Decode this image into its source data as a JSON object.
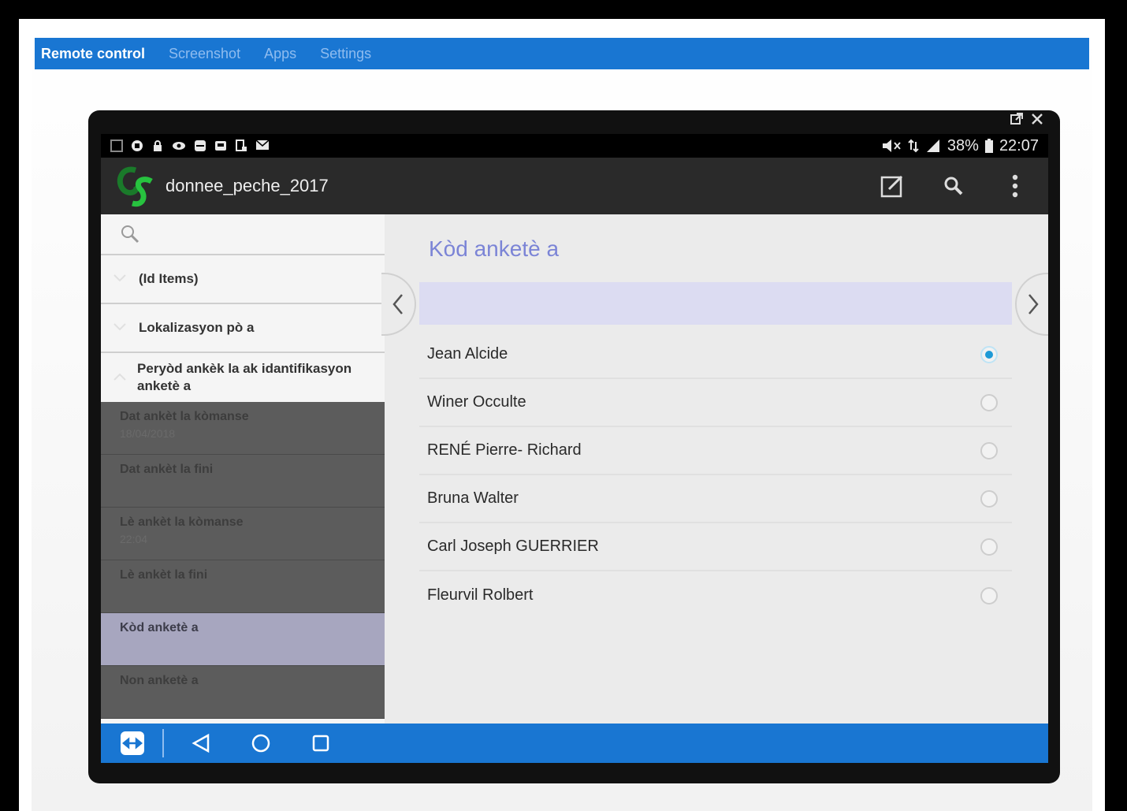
{
  "remote_nav": {
    "items": [
      {
        "label": "Remote control",
        "active": true
      },
      {
        "label": "Screenshot"
      },
      {
        "label": "Apps"
      },
      {
        "label": "Settings"
      }
    ]
  },
  "device": {
    "window_controls": {
      "detach_icon": "detach-icon",
      "close_icon": "close-icon"
    },
    "status_bar": {
      "left_icons": [
        "notification-icon",
        "vpn-icon",
        "lock-icon",
        "eye-icon",
        "teamviewer-icon",
        "wifi-icon",
        "screenshot-icon",
        "email-icon"
      ],
      "battery": "38%",
      "time": "22:07"
    },
    "action_bar": {
      "title": "donnee_peche_2017",
      "icons": [
        "edit-icon",
        "search-icon",
        "overflow-icon"
      ]
    }
  },
  "sidebar": {
    "search_icon": "search-icon",
    "groups": [
      {
        "label": "(Id Items)"
      },
      {
        "label": "Lokalizasyon pò a"
      },
      {
        "label": "Peryòd ankèk la ak idantifikasyon anketè a"
      }
    ],
    "questions": [
      {
        "label": "Dat ankèt la kòmanse",
        "value": "18/04/2018"
      },
      {
        "label": "Dat  ankèt la fini",
        "value": ""
      },
      {
        "label": "Lè ankèt la kòmanse",
        "value": "22:04"
      },
      {
        "label": "Lè ankèt la fini",
        "value": ""
      },
      {
        "label": "Kòd anketè a",
        "value": "",
        "selected": true
      },
      {
        "label": "Non anketè a",
        "value": ""
      }
    ]
  },
  "question": {
    "title": "Kòd anketè a",
    "options": [
      {
        "label": "Jean Alcide",
        "checked": true
      },
      {
        "label": "Winer Occulte",
        "checked": false
      },
      {
        "label": "RENÉ Pierre- Richard",
        "checked": false
      },
      {
        "label": "Bruna Walter",
        "checked": false
      },
      {
        "label": "Carl Joseph GUERRIER",
        "checked": false
      },
      {
        "label": "Fleurvil Rolbert",
        "checked": false
      }
    ]
  },
  "nav_bar": {
    "icons": [
      "teamviewer-icon",
      "back-icon",
      "home-icon",
      "recents-icon"
    ]
  },
  "colors": {
    "accent": "#1976d2",
    "question_title": "#7b84d6",
    "radio_checked": "#1e9ad6",
    "selected_row": "#a7a6bf"
  }
}
